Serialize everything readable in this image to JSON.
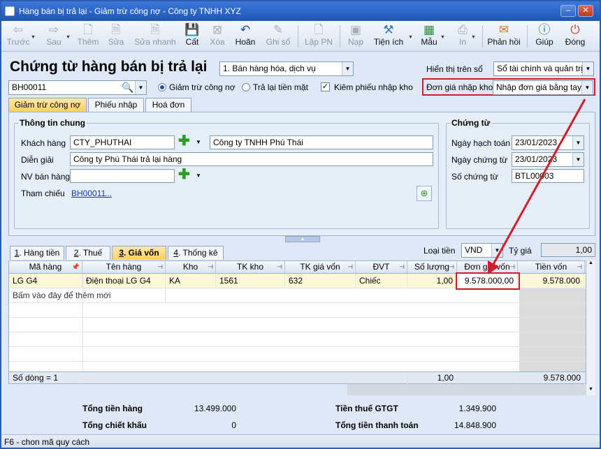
{
  "window": {
    "title": "Hàng bán bị trả lại - Giảm trừ công nợ - Công ty TNHH XYZ"
  },
  "toolbar": [
    {
      "label": "Trước",
      "icon": "arrow-left-icon",
      "enabled": false
    },
    {
      "label": "Sau",
      "icon": "arrow-right-icon",
      "enabled": false
    },
    {
      "label": "Thêm",
      "icon": "new-document-icon",
      "enabled": false
    },
    {
      "label": "Sửa",
      "icon": "edit-icon",
      "enabled": false
    },
    {
      "label": "Sửa nhanh",
      "icon": "quick-edit-icon",
      "enabled": false
    },
    {
      "label": "Cất",
      "icon": "save-icon",
      "enabled": true
    },
    {
      "label": "Xóa",
      "icon": "delete-icon",
      "enabled": false
    },
    {
      "label": "Hoãn",
      "icon": "undo-icon",
      "enabled": true
    },
    {
      "label": "Ghi sổ",
      "icon": "pencil-icon",
      "enabled": false
    },
    {
      "label": "Lập PN",
      "icon": "create-receipt-icon",
      "enabled": false
    },
    {
      "label": "Nạp",
      "icon": "reload-icon",
      "enabled": false
    },
    {
      "label": "Tiện ích",
      "icon": "tools-icon",
      "enabled": true
    },
    {
      "label": "Mẫu",
      "icon": "template-icon",
      "enabled": true
    },
    {
      "label": "In",
      "icon": "print-icon",
      "enabled": false
    },
    {
      "label": "Phản hồi",
      "icon": "feedback-mail-icon",
      "enabled": true
    },
    {
      "label": "Giúp",
      "icon": "help-icon",
      "enabled": true
    },
    {
      "label": "Đóng",
      "icon": "close-icon",
      "enabled": true
    }
  ],
  "header": {
    "title": "Chứng từ hàng bán bị trả lại",
    "type_select": "1. Bán hàng hóa, dịch vụ",
    "display_label": "Hiển thị trên sổ",
    "display_select": "Sổ tài chính và quản trị",
    "doc_ref": "BH00011",
    "radio_reduce": "Giảm trừ công nợ",
    "radio_refund": "Trả lại tiền mặt",
    "check_receipt": "Kiêm phiếu nhập kho",
    "price_label": "Đơn giá nhập kho",
    "price_select": "Nhập đơn giá bằng tay"
  },
  "tabs_top": [
    "Giảm trừ công nợ",
    "Phiếu nhập",
    "Hoá đơn"
  ],
  "general": {
    "title": "Thông tin chung",
    "customer_label": "Khách hàng",
    "customer_code": "CTY_PHUTHAI",
    "customer_name": "Công ty TNHH Phú Thái",
    "desc_label": "Diễn giải",
    "desc_value": "Công ty Phú Thái trả lại hàng",
    "seller_label": "NV bán hàng",
    "ref_label": "Tham chiếu",
    "ref_link": "BH00011",
    "ref_more": "..."
  },
  "voucher": {
    "title": "Chứng từ",
    "post_date_label": "Ngày hạch toán",
    "post_date": "23/01/2023",
    "doc_date_label": "Ngày chứng từ",
    "doc_date": "23/01/2023",
    "doc_no_label": "Số chứng từ",
    "doc_no": "BTL00003"
  },
  "tabs_bottom": [
    {
      "key": "1",
      "label": "Hàng tiền"
    },
    {
      "key": "2",
      "label": "Thuế"
    },
    {
      "key": "3",
      "label": "Giá vốn"
    },
    {
      "key": "4",
      "label": "Thống kê"
    }
  ],
  "currency": {
    "label": "Loại tiền",
    "value": "VND",
    "rate_label": "Tỷ giá",
    "rate": "1,00"
  },
  "grid": {
    "columns": [
      "Mã hàng",
      "Tên hàng",
      "Kho",
      "TK kho",
      "TK giá vốn",
      "ĐVT",
      "Số lượng",
      "Đơn giá vốn",
      "Tiền vốn"
    ],
    "rows": [
      [
        "LG G4",
        "Điện thoại LG G4",
        "KA",
        "1561",
        "632",
        "Chiếc",
        "1,00",
        "9.578.000,00",
        "9.578.000"
      ]
    ],
    "add_row_hint": "Bấm vào đây để thêm mới",
    "footer": {
      "count": "Số dòng = 1",
      "qty_total": "1,00",
      "amount_total": "9.578.000"
    }
  },
  "summary": {
    "goods_label": "Tổng tiền hàng",
    "goods_value": "13.499.000",
    "discount_label": "Tổng chiết khấu",
    "discount_value": "0",
    "vat_label": "Tiền thuế GTGT",
    "vat_value": "1.349.900",
    "payment_label": "Tổng tiền thanh toán",
    "payment_value": "14.848.900"
  },
  "status": "F6 - chon mã quy cách",
  "colors": {
    "title_bar": "#1f56b6",
    "active_tab": "#ffd15d",
    "highlight_box": "#d21c2c"
  }
}
